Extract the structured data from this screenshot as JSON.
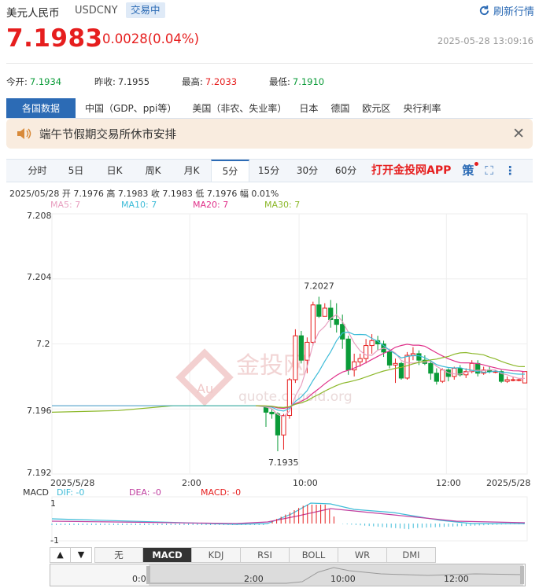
{
  "header": {
    "name": "美元人民币",
    "code": "USDCNY",
    "status": "交易中",
    "refresh": "刷新行情"
  },
  "quote": {
    "price": "7.1983",
    "change": "0.0028(0.04%)",
    "time": "2025-05-28 13:09:16"
  },
  "stats": [
    {
      "label": "今开:",
      "value": "7.1934",
      "color": "#0a9b38"
    },
    {
      "label": "昨收:",
      "value": "7.1955",
      "color": "#333333"
    },
    {
      "label": "最高:",
      "value": "7.2033",
      "color": "#e61e1e"
    },
    {
      "label": "最低:",
      "value": "7.1910",
      "color": "#0a9b38"
    }
  ],
  "tabs1": [
    "各国数据",
    "中国（GDP、ppi等）",
    "美国（非农、失业率）",
    "日本",
    "德国",
    "欧元区",
    "央行利率"
  ],
  "notice": {
    "text": "端午节假期交易所休市安排"
  },
  "tabs2": [
    "分时",
    "5日",
    "日K",
    "周K",
    "月K",
    "5分",
    "15分",
    "30分",
    "60分"
  ],
  "tabs2_active": 5,
  "app_link": "打开金投网APP",
  "strategy_label": "策",
  "ohlc_line": "2025/05/28 开 7.1976 高 7.1983 收 7.1983 低 7.1976 幅 0.01%",
  "ma_labels": [
    {
      "text": "MA5: 7",
      "color": "#e8a0c0"
    },
    {
      "text": "MA10: 7",
      "color": "#3fbcd8"
    },
    {
      "text": "MA20: 7",
      "color": "#e0308a"
    },
    {
      "text": "MA30: 7",
      "color": "#8cb82a"
    }
  ],
  "watermark": {
    "brand": "金投网",
    "site": "quote.cngold.org",
    "logo": "Au"
  },
  "macd_labels": [
    {
      "text": "MACD",
      "color": "#333333"
    },
    {
      "text": "DIF: -0",
      "color": "#3fbcd8"
    },
    {
      "text": "DEA: -0",
      "color": "#c040a0"
    },
    {
      "text": "MACD: -0",
      "color": "#e61e1e"
    }
  ],
  "tabs3": [
    "无",
    "MACD",
    "KDJ",
    "RSI",
    "BOLL",
    "WR",
    "DMI"
  ],
  "tabs3_active": 1,
  "chart_data": {
    "type": "candlestick",
    "ylim": [
      7.192,
      7.208
    ],
    "yticks": [
      "7.208",
      "7.204",
      "7.2",
      "7.196",
      "7.192"
    ],
    "xticks": [
      {
        "label": "2025/5/28",
        "pos": 0
      },
      {
        "label": "2:00",
        "pos": 0.29
      },
      {
        "label": "10:00",
        "pos": 0.52
      },
      {
        "label": "12:00",
        "pos": 0.83
      },
      {
        "label": "2025/5/28",
        "pos": 1
      }
    ],
    "annotations": [
      {
        "text": "7.2027",
        "value": 7.2027
      },
      {
        "text": "7.1935",
        "value": 7.1935
      }
    ],
    "macd_ylim": [
      "1",
      "-1"
    ],
    "navigator_ticks": [
      "0:0",
      "2:00",
      "10:00",
      "12:00"
    ],
    "candles": [
      [
        7.1961,
        7.1962,
        7.1949,
        7.1958
      ],
      [
        7.1958,
        7.196,
        7.1954,
        7.1957
      ],
      [
        7.1957,
        7.1958,
        7.1934,
        7.1944
      ],
      [
        7.1944,
        7.1957,
        7.1935,
        7.1956
      ],
      [
        7.1956,
        7.1979,
        7.1954,
        7.1978
      ],
      [
        7.1978,
        7.2009,
        7.1976,
        7.2005
      ],
      [
        7.2005,
        7.2008,
        7.1988,
        7.199
      ],
      [
        7.199,
        7.2004,
        7.1982,
        7.2001
      ],
      [
        7.2001,
        7.2026,
        7.1999,
        7.2024
      ],
      [
        7.2024,
        7.2029,
        7.2016,
        7.2017
      ],
      [
        7.2017,
        7.2025,
        7.2018,
        7.2022
      ],
      [
        7.2022,
        7.2027,
        7.201,
        7.2015
      ],
      [
        7.2015,
        7.2025,
        7.2007,
        7.2012
      ],
      [
        7.2012,
        7.2018,
        7.1997,
        7.2003
      ],
      [
        7.2003,
        7.2005,
        7.1981,
        7.1984
      ],
      [
        7.1984,
        7.1994,
        7.198,
        7.1989
      ],
      [
        7.1989,
        7.1994,
        7.1986,
        7.1991
      ],
      [
        7.1991,
        7.2003,
        7.1988,
        7.1999
      ],
      [
        7.1999,
        7.2006,
        7.1994,
        7.2002
      ],
      [
        7.2002,
        7.2005,
        7.1996,
        7.2
      ],
      [
        7.2,
        7.2002,
        7.1992,
        7.1995
      ],
      [
        7.1995,
        7.1997,
        7.1985,
        7.1987
      ],
      [
        7.1987,
        7.1991,
        7.1976,
        7.1988
      ],
      [
        7.1988,
        7.1989,
        7.1978,
        7.1979
      ],
      [
        7.1979,
        7.1995,
        7.1978,
        7.1993
      ],
      [
        7.1993,
        7.1998,
        7.199,
        7.1994
      ],
      [
        7.1994,
        7.1996,
        7.1987,
        7.199
      ],
      [
        7.199,
        7.1993,
        7.1987,
        7.1988
      ],
      [
        7.1988,
        7.199,
        7.1978,
        7.1982
      ],
      [
        7.1982,
        7.1985,
        7.1975,
        7.1977
      ],
      [
        7.1977,
        7.1985,
        7.1976,
        7.1984
      ],
      [
        7.1984,
        7.1985,
        7.1977,
        7.198
      ],
      [
        7.198,
        7.1986,
        7.1978,
        7.1985
      ],
      [
        7.1985,
        7.1987,
        7.198,
        7.1981
      ],
      [
        7.1981,
        7.1985,
        7.1979,
        7.1983
      ],
      [
        7.1983,
        7.199,
        7.1982,
        7.1988
      ],
      [
        7.1988,
        7.199,
        7.198,
        7.1982
      ],
      [
        7.1982,
        7.1986,
        7.1981,
        7.1984
      ],
      [
        7.1984,
        7.1986,
        7.1982,
        7.1983
      ],
      [
        7.1983,
        7.1984,
        7.1982,
        7.1983
      ],
      [
        7.1983,
        7.1984,
        7.1976,
        7.1977
      ],
      [
        7.1977,
        7.198,
        7.1976,
        7.1978
      ],
      [
        7.1978,
        7.198,
        7.1977,
        7.1978
      ],
      [
        7.1978,
        7.1979,
        7.1977,
        7.1978
      ],
      [
        7.1976,
        7.1983,
        7.1976,
        7.1983
      ]
    ]
  }
}
